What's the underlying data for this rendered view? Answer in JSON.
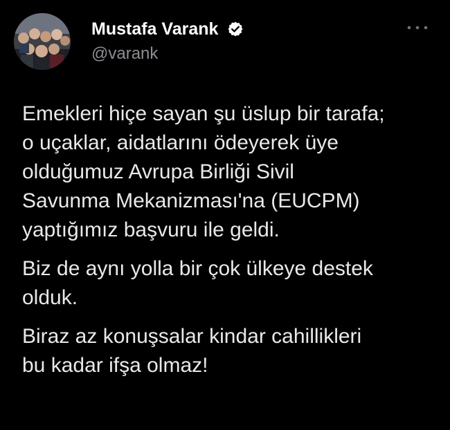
{
  "author": {
    "name": "Mustafa Varank",
    "handle": "@varank",
    "verified": true,
    "avatar_icon": "avatar-group-photo"
  },
  "header": {
    "more_icon": "more-horizontal-icon"
  },
  "tweet": {
    "paragraphs": [
      "Emekleri hiçe sayan şu üslup bir tarafa;\no uçaklar, aidatlarını ödeyerek üye\nolduğumuz Avrupa Birliği Sivil\nSavunma Mekanizması'na (EUCPM)\nyaptığımız başvuru ile geldi.",
      "Biz de aynı yolla bir çok ülkeye destek\nolduk.",
      "Biraz az konuşsalar kindar cahillikleri\nbu kadar ifşa olmaz!"
    ]
  },
  "colors": {
    "background": "#000000",
    "text": "#e7e9ea",
    "secondary": "#8b8f94",
    "verified_badge": "#ffffff"
  }
}
